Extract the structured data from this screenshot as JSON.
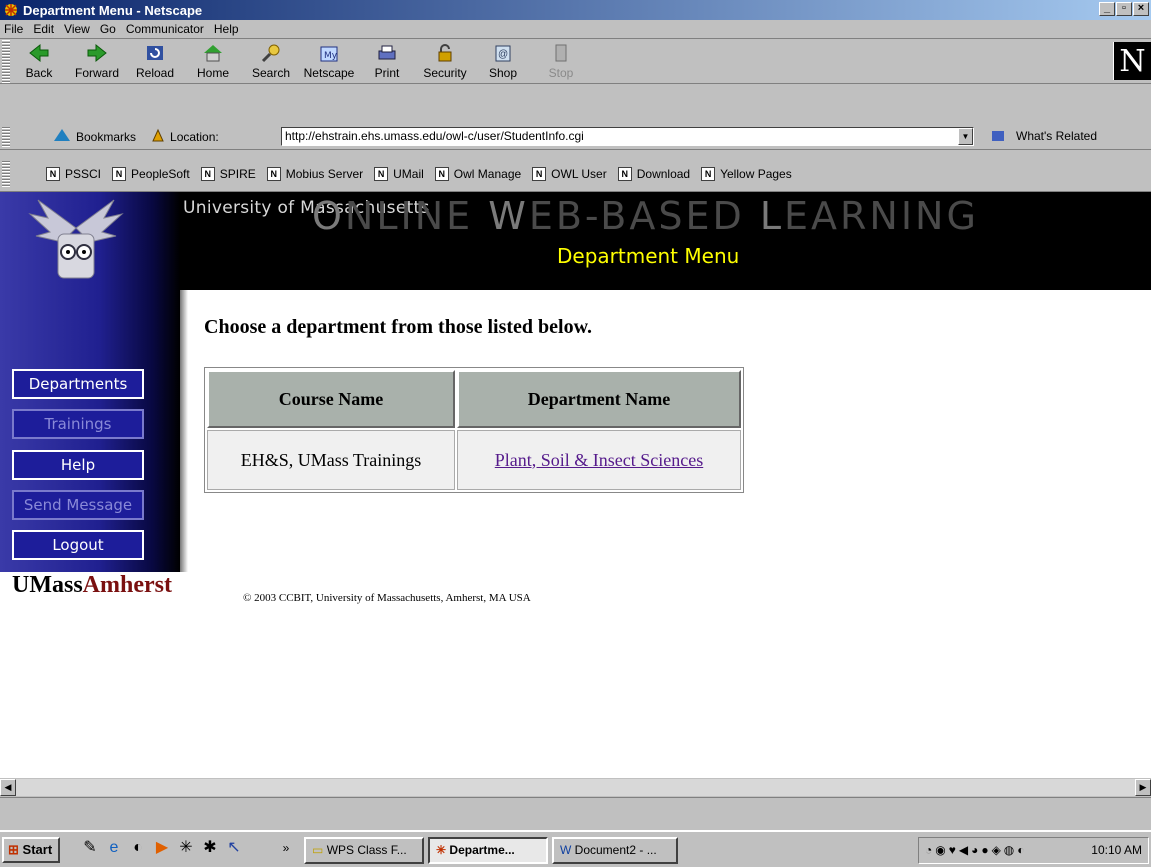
{
  "window": {
    "title": "Department Menu - Netscape"
  },
  "menubar": [
    "File",
    "Edit",
    "View",
    "Go",
    "Communicator",
    "Help"
  ],
  "nav_toolbar": {
    "buttons": [
      {
        "label": "Back",
        "icon": "back-arrow-icon"
      },
      {
        "label": "Forward",
        "icon": "forward-arrow-icon"
      },
      {
        "label": "Reload",
        "icon": "reload-icon"
      },
      {
        "label": "Home",
        "icon": "home-icon"
      },
      {
        "label": "Search",
        "icon": "search-icon"
      },
      {
        "label": "Netscape",
        "icon": "my-netscape-icon"
      },
      {
        "label": "Print",
        "icon": "print-icon"
      },
      {
        "label": "Security",
        "icon": "lock-icon"
      },
      {
        "label": "Shop",
        "icon": "shop-icon"
      },
      {
        "label": "Stop",
        "icon": "stop-icon"
      }
    ]
  },
  "location_bar": {
    "bookmarks": "Bookmarks",
    "location_label": "Location:",
    "url": "http://ehstrain.ehs.umass.edu/owl-c/user/StudentInfo.cgi",
    "whats_related": "What's Related"
  },
  "personal_toolbar": [
    "PSSCI",
    "PeopleSoft",
    "SPIRE",
    "Mobius Server",
    "UMail",
    "Owl Manage",
    "OWL User",
    "Download",
    "Yellow Pages"
  ],
  "banner": {
    "university": "University of Massachusetts",
    "title_parts": [
      "O",
      "NLINE ",
      "W",
      "EB-BASED ",
      "L",
      "EARNING"
    ],
    "subtitle": "Department Menu"
  },
  "sidebar": {
    "buttons": [
      {
        "label": "Departments",
        "enabled": true
      },
      {
        "label": "Trainings",
        "enabled": false
      },
      {
        "label": "Help",
        "enabled": true
      },
      {
        "label": "Send Message",
        "enabled": false
      },
      {
        "label": "Logout",
        "enabled": true
      }
    ]
  },
  "main": {
    "heading": "Choose a department from those listed below.",
    "table": {
      "headers": [
        "Course Name",
        "Department Name"
      ],
      "rows": [
        {
          "course": "EH&S, UMass Trainings",
          "department": "Plant, Soil & Insect Sciences"
        }
      ]
    }
  },
  "footer": {
    "logo_part1": "UMass",
    "logo_part2": "Amherst",
    "copyright": "© 2003 CCBIT, University of Massachusetts, Amherst, MA USA"
  },
  "taskbar": {
    "start": "Start",
    "tasks": [
      {
        "label": "WPS Class F...",
        "active": false
      },
      {
        "label": "Departme...",
        "active": true
      },
      {
        "label": "Document2 - ...",
        "active": false
      }
    ],
    "clock": "10:10 AM"
  },
  "colors": {
    "title_bar": "#0a246a",
    "banner_subtitle": "#ffff00",
    "sidebar": "#202090",
    "link": "#551a8b",
    "table_header": "#a9b1ab",
    "amherst": "#7a1010"
  }
}
